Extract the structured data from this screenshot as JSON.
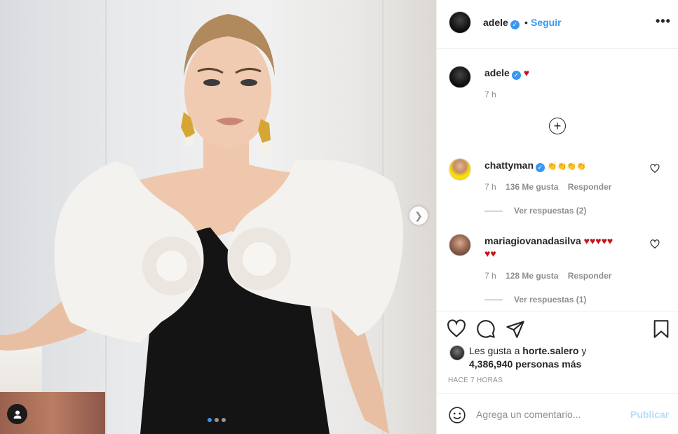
{
  "post": {
    "username": "adele",
    "follow_label": "Seguir",
    "separator": "•",
    "more_label": "•••",
    "caption_emoji": "♥",
    "caption_time": "7 h",
    "load_more_icon": "+",
    "carousel_dots": 3,
    "carousel_active_index": 0
  },
  "comments": [
    {
      "username": "chattyman",
      "text": "👏👏👏👏",
      "time": "7 h",
      "likes": "136 Me gusta",
      "reply_label": "Responder",
      "view_replies": "Ver respuestas (2)"
    },
    {
      "username": "mariagiovanadasilva",
      "text": "♥♥♥♥♥",
      "text_line2": "♥♥",
      "time": "7 h",
      "likes": "128 Me gusta",
      "reply_label": "Responder",
      "view_replies": "Ver respuestas (1)"
    }
  ],
  "likes": {
    "prefix": "Les gusta a",
    "liked_by": "horte.salero",
    "suffix": "y",
    "others": "4,386,940 personas más"
  },
  "timestamp": "HACE 7 HORAS",
  "add_comment": {
    "placeholder": "Agrega un comentario...",
    "publish_label": "Publicar"
  },
  "colors": {
    "accent": "#3897f0",
    "publish_disabled": "#b2dffc",
    "heart": "#c4161c",
    "muted": "#8e8e8e"
  },
  "icons": [
    "chevron-right-icon",
    "user-tag-icon",
    "more-options-icon",
    "verified-icon",
    "plus-circle-icon",
    "heart-icon",
    "comment-icon",
    "share-icon",
    "bookmark-icon",
    "emoji-icon"
  ]
}
